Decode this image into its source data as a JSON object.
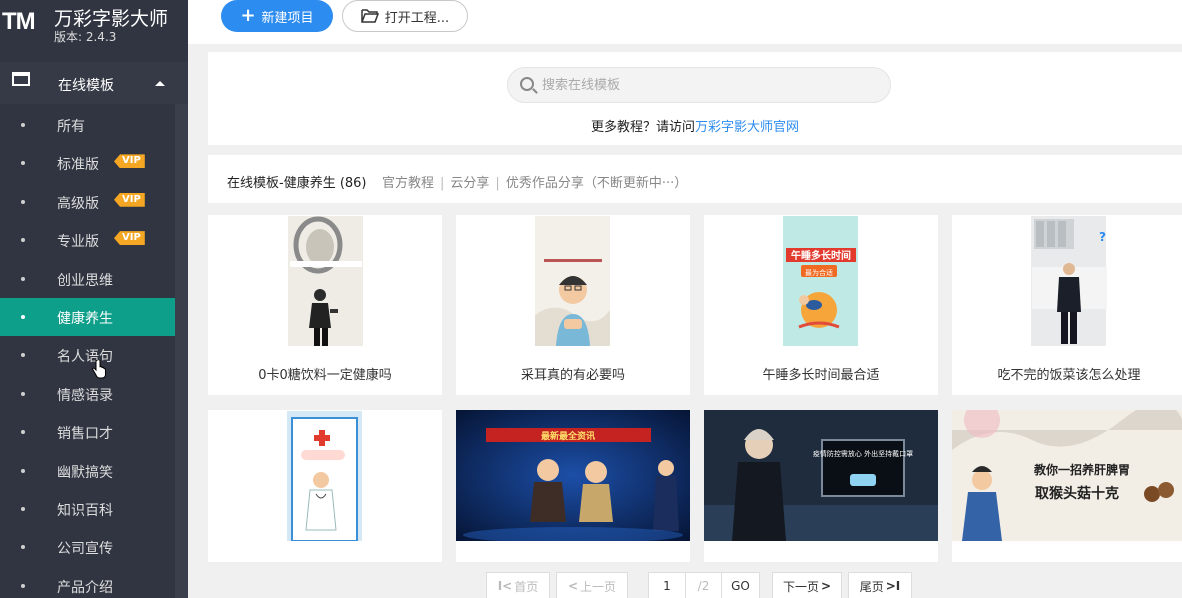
{
  "app": {
    "logo": "TM",
    "title": "万彩字影大师",
    "version": "版本: 2.4.3"
  },
  "sidebar": {
    "section_label": "在线模板",
    "items": [
      {
        "label": "所有",
        "vip": ""
      },
      {
        "label": "标准版",
        "vip": "VIP"
      },
      {
        "label": "高级版",
        "vip": "VIP"
      },
      {
        "label": "专业版",
        "vip": "VIP"
      },
      {
        "label": "创业思维",
        "vip": ""
      },
      {
        "label": "健康养生",
        "vip": "",
        "active": true
      },
      {
        "label": "名人语句",
        "vip": ""
      },
      {
        "label": "情感语录",
        "vip": ""
      },
      {
        "label": "销售口才",
        "vip": ""
      },
      {
        "label": "幽默搞笑",
        "vip": ""
      },
      {
        "label": "知识百科",
        "vip": ""
      },
      {
        "label": "公司宣传",
        "vip": ""
      },
      {
        "label": "产品介绍",
        "vip": ""
      }
    ]
  },
  "toolbar": {
    "new_project": "新建项目",
    "open_project": "打开工程..."
  },
  "search": {
    "placeholder": "搜索在线模板",
    "tutorial_prefix": "更多教程？请访问",
    "tutorial_link": "万彩字影大师官网"
  },
  "filter": {
    "current": "在线模板-健康养生 (86)",
    "links": [
      "官方教程",
      "云分享",
      "优秀作品分享（不断更新中···）"
    ]
  },
  "cards": [
    {
      "caption": "0卡0糖饮料一定健康吗"
    },
    {
      "caption": "采耳真的有必要吗"
    },
    {
      "caption": "午睡多长时间最合适",
      "thumb_title": "午睡多长时间",
      "thumb_sub": "最为合适"
    },
    {
      "caption": "吃不完的饭菜该怎么处理"
    },
    {
      "caption": ""
    },
    {
      "caption": "",
      "thumb_title": "最新最全资讯"
    },
    {
      "caption": "",
      "thumb_title": "疫情防控需放心 外出坚持戴口罩"
    },
    {
      "caption": "",
      "thumb_title": "教你一招养肝脾胃",
      "thumb_sub": "取猴头菇十克"
    }
  ],
  "pager": {
    "first": "首页",
    "prev": "上一页",
    "current": "1",
    "total": "/2",
    "go": "GO",
    "next": "下一页",
    "last": "尾页"
  },
  "colors": {
    "sidebar_bg": "#303541",
    "active": "#0e9f8b",
    "accent": "#2d8cf0",
    "vip": "#f5a623"
  }
}
